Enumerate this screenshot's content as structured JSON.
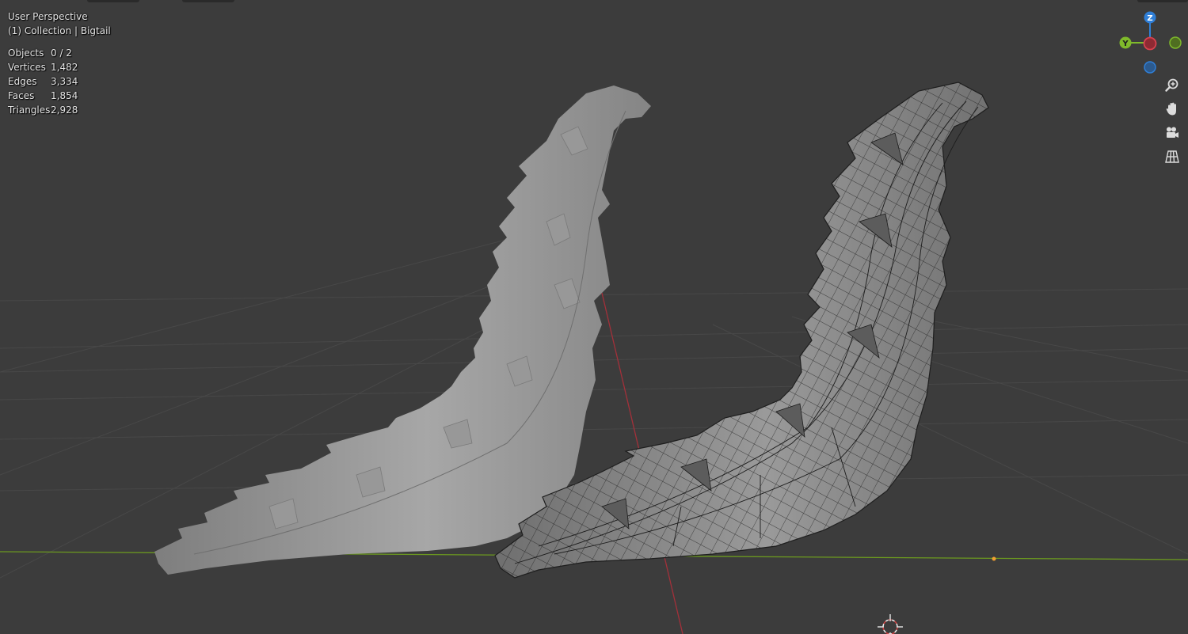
{
  "viewport": {
    "mode": "User Perspective",
    "collection": "(1) Collection | Bigtail"
  },
  "stats": [
    {
      "label": "Objects",
      "value": "0 / 2"
    },
    {
      "label": "Vertices",
      "value": "1,482"
    },
    {
      "label": "Edges",
      "value": "3,334"
    },
    {
      "label": "Faces",
      "value": "1,854"
    },
    {
      "label": "Triangles",
      "value": "2,928"
    }
  ],
  "gizmo": {
    "z_label": "Z",
    "y_label": "Y",
    "colors": {
      "x": "#d7414e",
      "y": "#7fba2b",
      "z": "#2f7fd8"
    }
  },
  "nav_icons": [
    "zoom-icon",
    "pan-hand-icon",
    "camera-icon",
    "grid-projection-icon"
  ],
  "colors": {
    "background": "#3c3c3c",
    "grid": "#4a4a4a",
    "x_axis": "#a3303a",
    "y_axis": "#6c9a1f",
    "solid_mesh": "#8f8f8f",
    "wire_mesh": "#7d7d7d"
  }
}
